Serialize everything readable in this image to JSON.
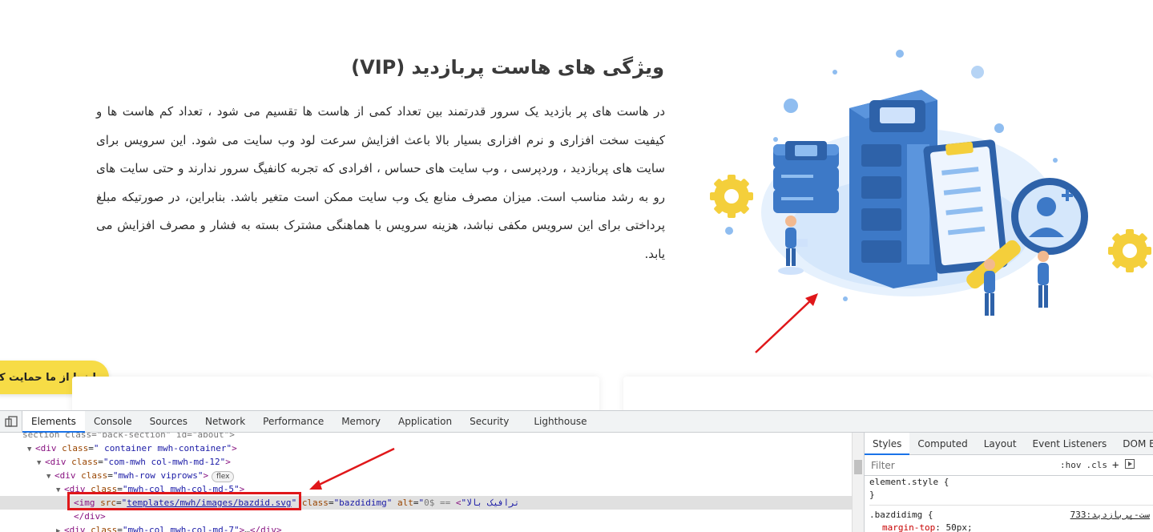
{
  "page": {
    "title": "ویژگی های هاست پربازدید (VIP)",
    "paragraph": "در هاست های پر بازدید یک سرور قدرتمند بین تعداد کمی از هاست ها تقسیم می شود ، تعداد کم هاست ها و کیفیت سخت افزاری و نرم افزاری بسیار بالا باعث افزایش سرعت لود وب سایت می شود. این سرویس برای سایت های پربازدید ، وردپرسی ، وب سایت های حساس ، افرادی که تجربه کانفیگ سرور ندارند و حتی سایت های رو به رشد مناسب است. میزان مصرف منابع یک وب سایت ممکن است متغیر باشد. بنابراین، در صورتیکه مبلغ پرداختی برای این سرویس مکفی نباشد، هزینه سرویس با هماهنگی مشترک بسته به فشار و مصرف افزایش می یابد.",
    "support_button": "اینجا از ما حمایت کنید",
    "colors": {
      "accent_yellow": "#f7dc46",
      "illustration_blue": "#3d79c7",
      "annotation_red": "#e0171a"
    }
  },
  "devtools": {
    "tabs": [
      "Elements",
      "Console",
      "Sources",
      "Network",
      "Performance",
      "Memory",
      "Application",
      "Security",
      "Lighthouse"
    ],
    "active_tab": "Elements",
    "dom": {
      "l0": {
        "text": "section class=\"back-section\" id=\"about\">"
      },
      "l1": {
        "tag": "div",
        "attr": "class",
        "val": "\" container mwh-container\""
      },
      "l2": {
        "tag": "div",
        "attr": "class",
        "val": "\"com-mwh col-mwh-md-12\""
      },
      "l3": {
        "tag": "div",
        "attr": "class",
        "val": "\"mwh-row viprows\"",
        "badge": "flex"
      },
      "l4": {
        "tag": "div",
        "attr": "class",
        "val": "\"mwh-col mwh-col-md-5\""
      },
      "l5": {
        "tag": "img",
        "src_attr": "src",
        "src_q": "\"",
        "src_val": "templates/mwh/images/bazdid.svg",
        "class_attr": "class",
        "class_val": "\"bazdidimg\"",
        "alt_attr": "alt",
        "alt_val": "\"ترافیک بالا\"",
        "suffix": "== $0"
      },
      "l6": {
        "text": "</div>"
      },
      "l7": {
        "tag": "div",
        "attr": "class",
        "val": "\"mwh-col mwh-col-md-7\"",
        "ellipsis": "…",
        "close": "</div>"
      }
    },
    "styles": {
      "tabs": [
        "Styles",
        "Computed",
        "Layout",
        "Event Listeners",
        "DOM Breakpo"
      ],
      "active_tab": "Styles",
      "filter_placeholder": "Filter",
      "hov": ":hov",
      "cls": ".cls",
      "plus": "+",
      "element_style": "element.style {",
      "close_brace": "}",
      "rule_selector": ".bazdidimg {",
      "rule_source": "ست-پربازدید:733",
      "rule_prop": "margin-top",
      "rule_value": "50px;"
    }
  }
}
